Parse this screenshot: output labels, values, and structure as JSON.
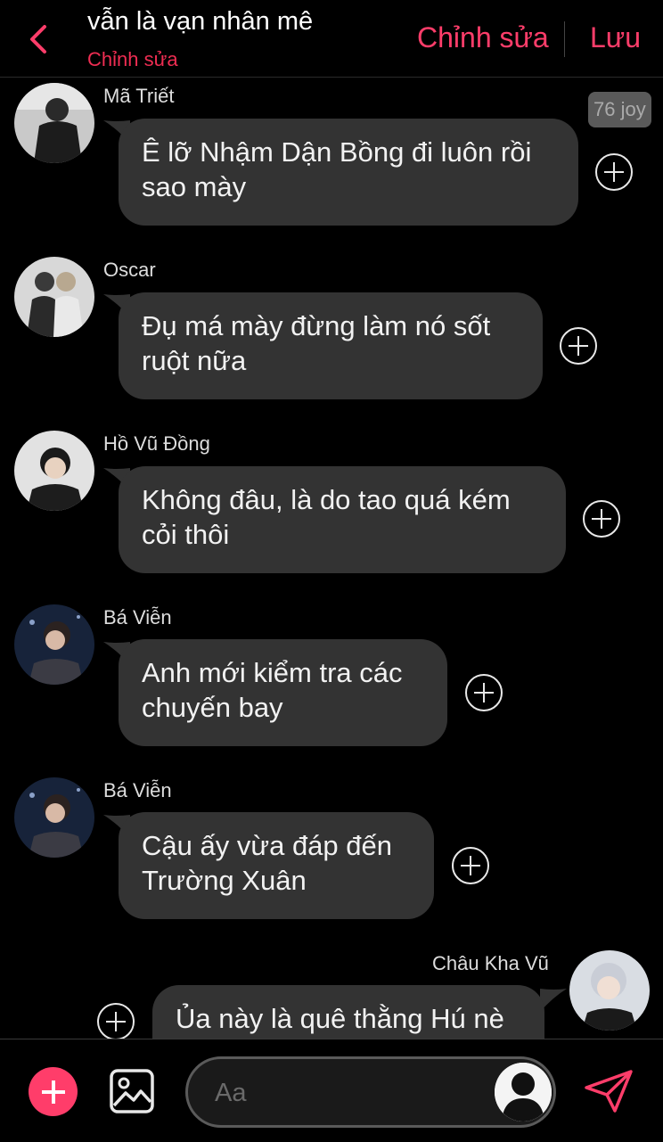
{
  "header": {
    "title": "vẫn là vạn nhân mê",
    "subtitle": "Chỉnh sửa",
    "edit_label": "Chỉnh sửa",
    "save_label": "Lưu"
  },
  "badge": "76 joy",
  "messages": [
    {
      "sender": "Mã Triết",
      "lines": [
        "Ê lỡ Nhậm Dận Bồng đi luôn rồi",
        "sao mày"
      ],
      "side": "left"
    },
    {
      "sender": "Oscar",
      "lines": [
        "Đụ má mày đừng làm nó sốt",
        "ruột nữa"
      ],
      "side": "left"
    },
    {
      "sender": "Hồ Vũ Đồng",
      "lines": [
        "Không đâu, là do tao quá kém",
        "cỏi thôi"
      ],
      "side": "left"
    },
    {
      "sender": "Bá Viễn",
      "lines": [
        "Anh mới kiểm tra các",
        "chuyến bay"
      ],
      "side": "left"
    },
    {
      "sender": "Bá Viễn",
      "lines": [
        "Cậu ấy vừa đáp đến",
        "Trường Xuân"
      ],
      "side": "left"
    },
    {
      "sender": "Châu Kha Vũ",
      "lines": [
        "Ủa này là quê thằng Hú nè"
      ],
      "side": "right"
    }
  ],
  "composer": {
    "placeholder": "Aa"
  },
  "colors": {
    "accent": "#ff3d6a",
    "bubble": "#333333",
    "background": "#000000"
  },
  "icons": {
    "back": "chevron-left-icon",
    "add": "plus-icon",
    "image": "image-icon",
    "send": "send-icon"
  }
}
